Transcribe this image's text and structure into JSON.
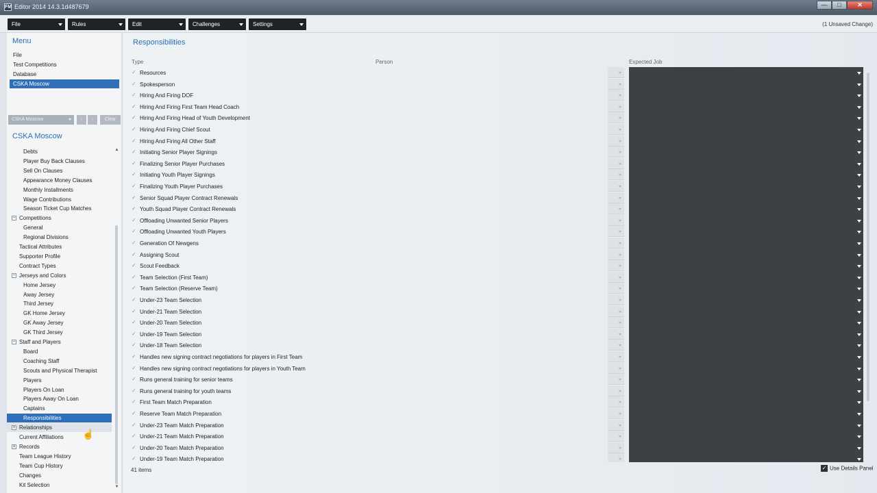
{
  "window": {
    "title": "Editor 2014 14.3.1d487679",
    "app_icon": "FM",
    "minimize": "—",
    "maximize": "□",
    "close": "✕"
  },
  "toolbar": {
    "menus": [
      "File",
      "Rules",
      "Edit",
      "Challenges",
      "Settings"
    ],
    "unsaved": "(1 Unsaved Change)"
  },
  "sidebar": {
    "menu_title": "Menu",
    "items": [
      "File",
      "Test Competitions",
      "Database",
      "CSKA Moscow"
    ],
    "selected_index": 3,
    "search": {
      "value": "CSKA Moscow",
      "prev": "‹",
      "next": "›",
      "clear": "Clear"
    },
    "club_title": "CSKA Moscow",
    "tree": [
      {
        "label": "Debts",
        "level": 2
      },
      {
        "label": "Player Buy Back Clauses",
        "level": 2
      },
      {
        "label": "Sell On Clauses",
        "level": 2
      },
      {
        "label": "Appearance Money Clauses",
        "level": 2
      },
      {
        "label": "Monthly Installments",
        "level": 2
      },
      {
        "label": "Wage Contributions",
        "level": 2
      },
      {
        "label": "Season Ticket Cup Matches",
        "level": 2
      },
      {
        "label": "Competitions",
        "level": 1,
        "expander": "−"
      },
      {
        "label": "General",
        "level": 2
      },
      {
        "label": "Regional Divisions",
        "level": 2
      },
      {
        "label": "Tactical Attributes",
        "level": 1
      },
      {
        "label": "Supporter Profile",
        "level": 1
      },
      {
        "label": "Contract Types",
        "level": 1
      },
      {
        "label": "Jerseys and Colors",
        "level": 1,
        "expander": "−"
      },
      {
        "label": "Home Jersey",
        "level": 2
      },
      {
        "label": "Away Jersey",
        "level": 2
      },
      {
        "label": "Third Jersey",
        "level": 2
      },
      {
        "label": "GK Home Jersey",
        "level": 2
      },
      {
        "label": "GK Away Jersey",
        "level": 2
      },
      {
        "label": "GK Third Jersey",
        "level": 2
      },
      {
        "label": "Staff and Players",
        "level": 1,
        "expander": "−"
      },
      {
        "label": "Board",
        "level": 2
      },
      {
        "label": "Coaching Staff",
        "level": 2
      },
      {
        "label": "Scouts and Physical Therapist",
        "level": 2
      },
      {
        "label": "Players",
        "level": 2
      },
      {
        "label": "Players On Loan",
        "level": 2
      },
      {
        "label": "Players Away On Loan",
        "level": 2
      },
      {
        "label": "Captains",
        "level": 2
      },
      {
        "label": "Responsibilities",
        "level": 2,
        "selected": true
      },
      {
        "label": "Relationships",
        "level": 1,
        "expander": "+",
        "hover": true
      },
      {
        "label": "Current Affiliations",
        "level": 1
      },
      {
        "label": "Records",
        "level": 1,
        "expander": "+"
      },
      {
        "label": "Team League History",
        "level": 1
      },
      {
        "label": "Team Cup History",
        "level": 1
      },
      {
        "label": "Changes",
        "level": 1
      },
      {
        "label": "Kit Selection",
        "level": 1
      }
    ],
    "scroll_up": "▲",
    "scroll_down": "▼"
  },
  "main": {
    "title": "Responsibilities",
    "columns": {
      "type": "Type",
      "person": "Person",
      "expected_job": "Expected Job"
    },
    "check_icon": "✓",
    "rows": [
      "Resources",
      "Spokesperson",
      "Hiring And Firing DOF",
      "Hiring And Firing First Team Head Coach",
      "Hiring And Firing Head of Youth Development",
      "Hiring And Firing Chief Scout",
      "Hiring And Firing All Other Staff",
      "Initiating Senior Player Signings",
      "Finalizing Senior Player Purchases",
      "Initiating Youth Player Signings",
      "Finalizing Youth Player Purchases",
      "Senior Squad Player Contract Renewals",
      "Youth Squad Player Contract Renewals",
      "Offloading Unwanted Senior Players",
      "Offloading Unwanted Youth Players",
      "Generation Of Newgens",
      "Assigning Scout",
      "Scout Feedback",
      "Team Selection (First Team)",
      "Team Selection (Reserve Team)",
      "Under-23 Team Selection",
      "Under-21 Team Selection",
      "Under-20 Team Selection",
      "Under-19 Team Selection",
      "Under-18 Team Selection",
      "Handles new signing contract negotiations for players in First Team",
      "Handles new signing contract negotiations for players in Youth Team",
      "Runs general training for senior teams",
      "Runs general training for youth teams",
      "First Team Match Preparation",
      "Reserve Team Match Preparation",
      "Under-23 Team Match Preparation",
      "Under-21 Team Match Preparation",
      "Under-20 Team Match Preparation",
      "Under-19 Team Match Preparation"
    ],
    "items_count": "41 items",
    "details_panel": {
      "checked": true,
      "check": "✓",
      "label": "Use Details Panel"
    }
  }
}
